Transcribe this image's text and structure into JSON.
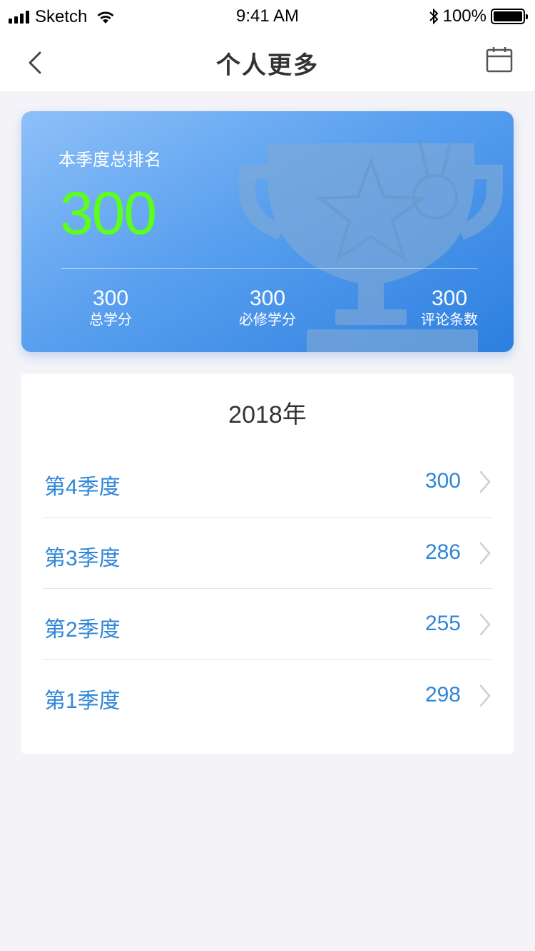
{
  "status_bar": {
    "carrier": "Sketch",
    "time": "9:41 AM",
    "battery": "100%"
  },
  "nav": {
    "title": "个人更多"
  },
  "summary": {
    "label": "本季度总排名",
    "rank": "300",
    "stats": [
      {
        "value": "300",
        "label": "总学分"
      },
      {
        "value": "300",
        "label": "必修学分"
      },
      {
        "value": "300",
        "label": "评论条数"
      }
    ]
  },
  "list": {
    "year": "2018年",
    "rows": [
      {
        "quarter": "第4季度",
        "value": "300"
      },
      {
        "quarter": "第3季度",
        "value": "286"
      },
      {
        "quarter": "第2季度",
        "value": "255"
      },
      {
        "quarter": "第1季度",
        "value": "298"
      }
    ]
  },
  "colors": {
    "accent": "#2f86d8",
    "rank": "#5cff1a",
    "card_start": "#8ec0f8",
    "card_end": "#2c7fe0"
  }
}
